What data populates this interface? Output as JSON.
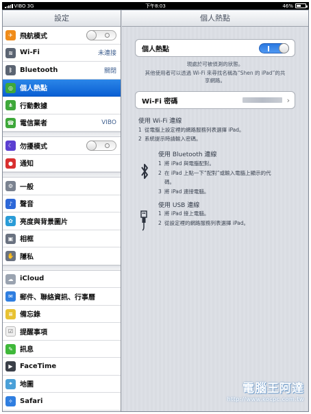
{
  "status_bar": {
    "carrier": "VIBO",
    "network": "3G",
    "time": "下午8:03",
    "battery_percent": "46%",
    "battery_level": 0.46
  },
  "master": {
    "title": "設定",
    "groups": [
      [
        {
          "label": "飛航模式",
          "icon": "airplane-icon",
          "icon_color": "#f08c1a",
          "toggle": "off"
        },
        {
          "label": "Wi-Fi",
          "icon": "wifi-icon",
          "icon_color": "#5b6472",
          "value": "未連接"
        },
        {
          "label": "Bluetooth",
          "icon": "bluetooth-icon",
          "icon_color": "#5b6472",
          "value": "關閉"
        },
        {
          "label": "個人熱點",
          "icon": "hotspot-icon",
          "icon_color": "#3ea83a",
          "selected": true
        },
        {
          "label": "行動數據",
          "icon": "cellular-icon",
          "icon_color": "#3ea83a"
        },
        {
          "label": "電信業者",
          "icon": "phone-icon",
          "icon_color": "#3ea83a",
          "value": "VIBO"
        }
      ],
      [
        {
          "label": "勿擾模式",
          "icon": "moon-icon",
          "icon_color": "#5b3fd1",
          "toggle": "off"
        },
        {
          "label": "通知",
          "icon": "notifications-icon",
          "icon_color": "#d93030"
        }
      ],
      [
        {
          "label": "一般",
          "icon": "gear-icon",
          "icon_color": "#7a8290"
        },
        {
          "label": "聲音",
          "icon": "speaker-icon",
          "icon_color": "#2d68d8"
        },
        {
          "label": "亮度與背景圖片",
          "icon": "wallpaper-icon",
          "icon_color": "#2a9cd7"
        },
        {
          "label": "相框",
          "icon": "picture-frame-icon",
          "icon_color": "#6a7280"
        },
        {
          "label": "隱私",
          "icon": "hand-icon",
          "icon_color": "#6a7280"
        }
      ],
      [
        {
          "label": "iCloud",
          "icon": "cloud-icon",
          "icon_color": "#9aa3b0"
        },
        {
          "label": "郵件、聯絡資訊、行事曆",
          "icon": "mail-icon",
          "icon_color": "#2f7ee0"
        },
        {
          "label": "備忘錄",
          "icon": "notes-icon",
          "icon_color": "#e8c232"
        },
        {
          "label": "提醒事項",
          "icon": "reminders-icon",
          "icon_color": "#f0f0f0"
        },
        {
          "label": "訊息",
          "icon": "messages-icon",
          "icon_color": "#3fb83a"
        },
        {
          "label": "FaceTime",
          "icon": "facetime-icon",
          "icon_color": "#3a3f48"
        },
        {
          "label": "地圖",
          "icon": "maps-icon",
          "icon_color": "#4aa0d8"
        },
        {
          "label": "Safari",
          "icon": "safari-icon",
          "icon_color": "#2f7ee0"
        }
      ]
    ]
  },
  "detail": {
    "title": "個人熱點",
    "hotspot_label": "個人熱點",
    "hotspot_on": true,
    "discoverable_note": "現處於可被偵測的狀態。",
    "share_note_line1": "其他使用者可以透過 Wi-Fi 來尋找名稱為“Shen 的 iPad”的共",
    "share_note_line2": "享網路。",
    "wifi_password_label": "Wi-Fi 密碼",
    "wifi_section": {
      "title": "使用 Wi-Fi 連線",
      "steps": [
        {
          "num": "1",
          "text": "從電腦上設定裡的網路服務列表選擇 iPad。"
        },
        {
          "num": "2",
          "text": "系統提示時請輸入密碼。"
        }
      ]
    },
    "bluetooth_section": {
      "title": "使用 Bluetooth 連線",
      "steps": [
        {
          "num": "1",
          "text": "將 iPad 與電腦配對。"
        },
        {
          "num": "2",
          "text": "在 iPad 上點一下“配對”或輸入電腦上顯示的代"
        },
        {
          "num": "",
          "text": "碼。"
        },
        {
          "num": "3",
          "text": "將 iPad 連接電腦。"
        }
      ]
    },
    "usb_section": {
      "title": "使用 USB 連線",
      "steps": [
        {
          "num": "1",
          "text": "將 iPad 接上電腦。"
        },
        {
          "num": "2",
          "text": "從設定裡的網路服務列表選擇 iPad。"
        }
      ]
    }
  },
  "watermark": {
    "title": "電腦王阿達",
    "url": "http://www.kocpc.com.tw"
  }
}
